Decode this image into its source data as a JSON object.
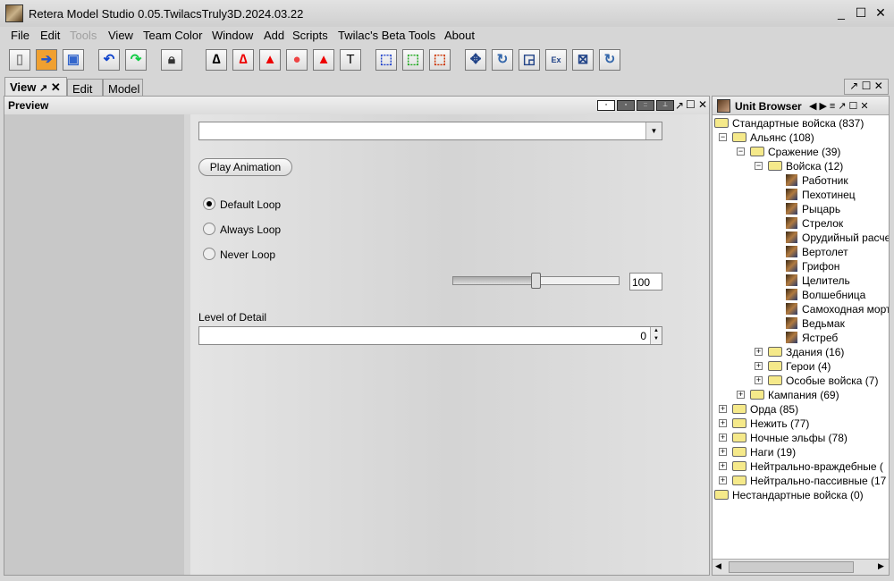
{
  "window": {
    "title": "Retera Model Studio 0.05.TwilacsTruly3D.2024.03.22"
  },
  "menu": [
    "File",
    "Edit",
    "Tools",
    "View",
    "Team Color",
    "Window",
    "Add",
    "Scripts",
    "Twilac's Beta Tools",
    "About"
  ],
  "toolbar": [
    "new",
    "open",
    "save",
    "undo",
    "redo",
    "lock",
    "select-vertex",
    "select-triangle",
    "select-geoset",
    "particle",
    "draw",
    "text",
    "select-rect",
    "add-select",
    "remove-select",
    "move",
    "rotate",
    "scale",
    "extrude",
    "extend",
    "rotate-alt"
  ],
  "tabs": {
    "view": "View",
    "edit": "Edit",
    "model": "Model"
  },
  "preview": {
    "title": "Preview",
    "animation_value": "",
    "play": "Play Animation",
    "loops": [
      "Default Loop",
      "Always Loop",
      "Never Loop"
    ],
    "selected_loop": 0,
    "speed": 100,
    "speed_label": "100",
    "lod_label": "Level of Detail",
    "lod_value": "0"
  },
  "unit_browser": {
    "title": "Unit Browser",
    "tree": [
      {
        "label": "Стандартные войска (837)",
        "level": 0,
        "type": "folder"
      },
      {
        "label": "Альянс (108)",
        "level": 1,
        "type": "folder",
        "exp": "-"
      },
      {
        "label": "Сражение (39)",
        "level": 2,
        "type": "folder",
        "exp": "-"
      },
      {
        "label": "Войска (12)",
        "level": 3,
        "type": "folder",
        "exp": "-"
      },
      {
        "label": "Работник",
        "level": 4,
        "type": "unit"
      },
      {
        "label": "Пехотинец",
        "level": 4,
        "type": "unit"
      },
      {
        "label": "Рыцарь",
        "level": 4,
        "type": "unit"
      },
      {
        "label": "Стрелок",
        "level": 4,
        "type": "unit"
      },
      {
        "label": "Орудийный расчет",
        "level": 4,
        "type": "unit"
      },
      {
        "label": "Вертолет",
        "level": 4,
        "type": "unit"
      },
      {
        "label": "Грифон",
        "level": 4,
        "type": "unit"
      },
      {
        "label": "Целитель",
        "level": 4,
        "type": "unit"
      },
      {
        "label": "Волшебница",
        "level": 4,
        "type": "unit"
      },
      {
        "label": "Самоходная мортира",
        "level": 4,
        "type": "unit"
      },
      {
        "label": "Ведьмак",
        "level": 4,
        "type": "unit"
      },
      {
        "label": "Ястреб",
        "level": 4,
        "type": "unit"
      },
      {
        "label": "Здания (16)",
        "level": 3,
        "type": "folder",
        "exp": "+"
      },
      {
        "label": "Герои (4)",
        "level": 3,
        "type": "folder",
        "exp": "+"
      },
      {
        "label": "Особые войска (7)",
        "level": 3,
        "type": "folder",
        "exp": "+"
      },
      {
        "label": "Кампания (69)",
        "level": 2,
        "type": "folder",
        "exp": "+"
      },
      {
        "label": "Орда (85)",
        "level": 1,
        "type": "folder",
        "exp": "+"
      },
      {
        "label": "Нежить (77)",
        "level": 1,
        "type": "folder",
        "exp": "+"
      },
      {
        "label": "Ночные эльфы (78)",
        "level": 1,
        "type": "folder",
        "exp": "+"
      },
      {
        "label": "Наги (19)",
        "level": 1,
        "type": "folder",
        "exp": "+"
      },
      {
        "label": "Нейтрально-враждебные (",
        "level": 1,
        "type": "folder",
        "exp": "+"
      },
      {
        "label": "Нейтрально-пассивные (17",
        "level": 1,
        "type": "folder",
        "exp": "+"
      },
      {
        "label": "Нестандартные войска (0)",
        "level": 0,
        "type": "folder"
      }
    ]
  }
}
